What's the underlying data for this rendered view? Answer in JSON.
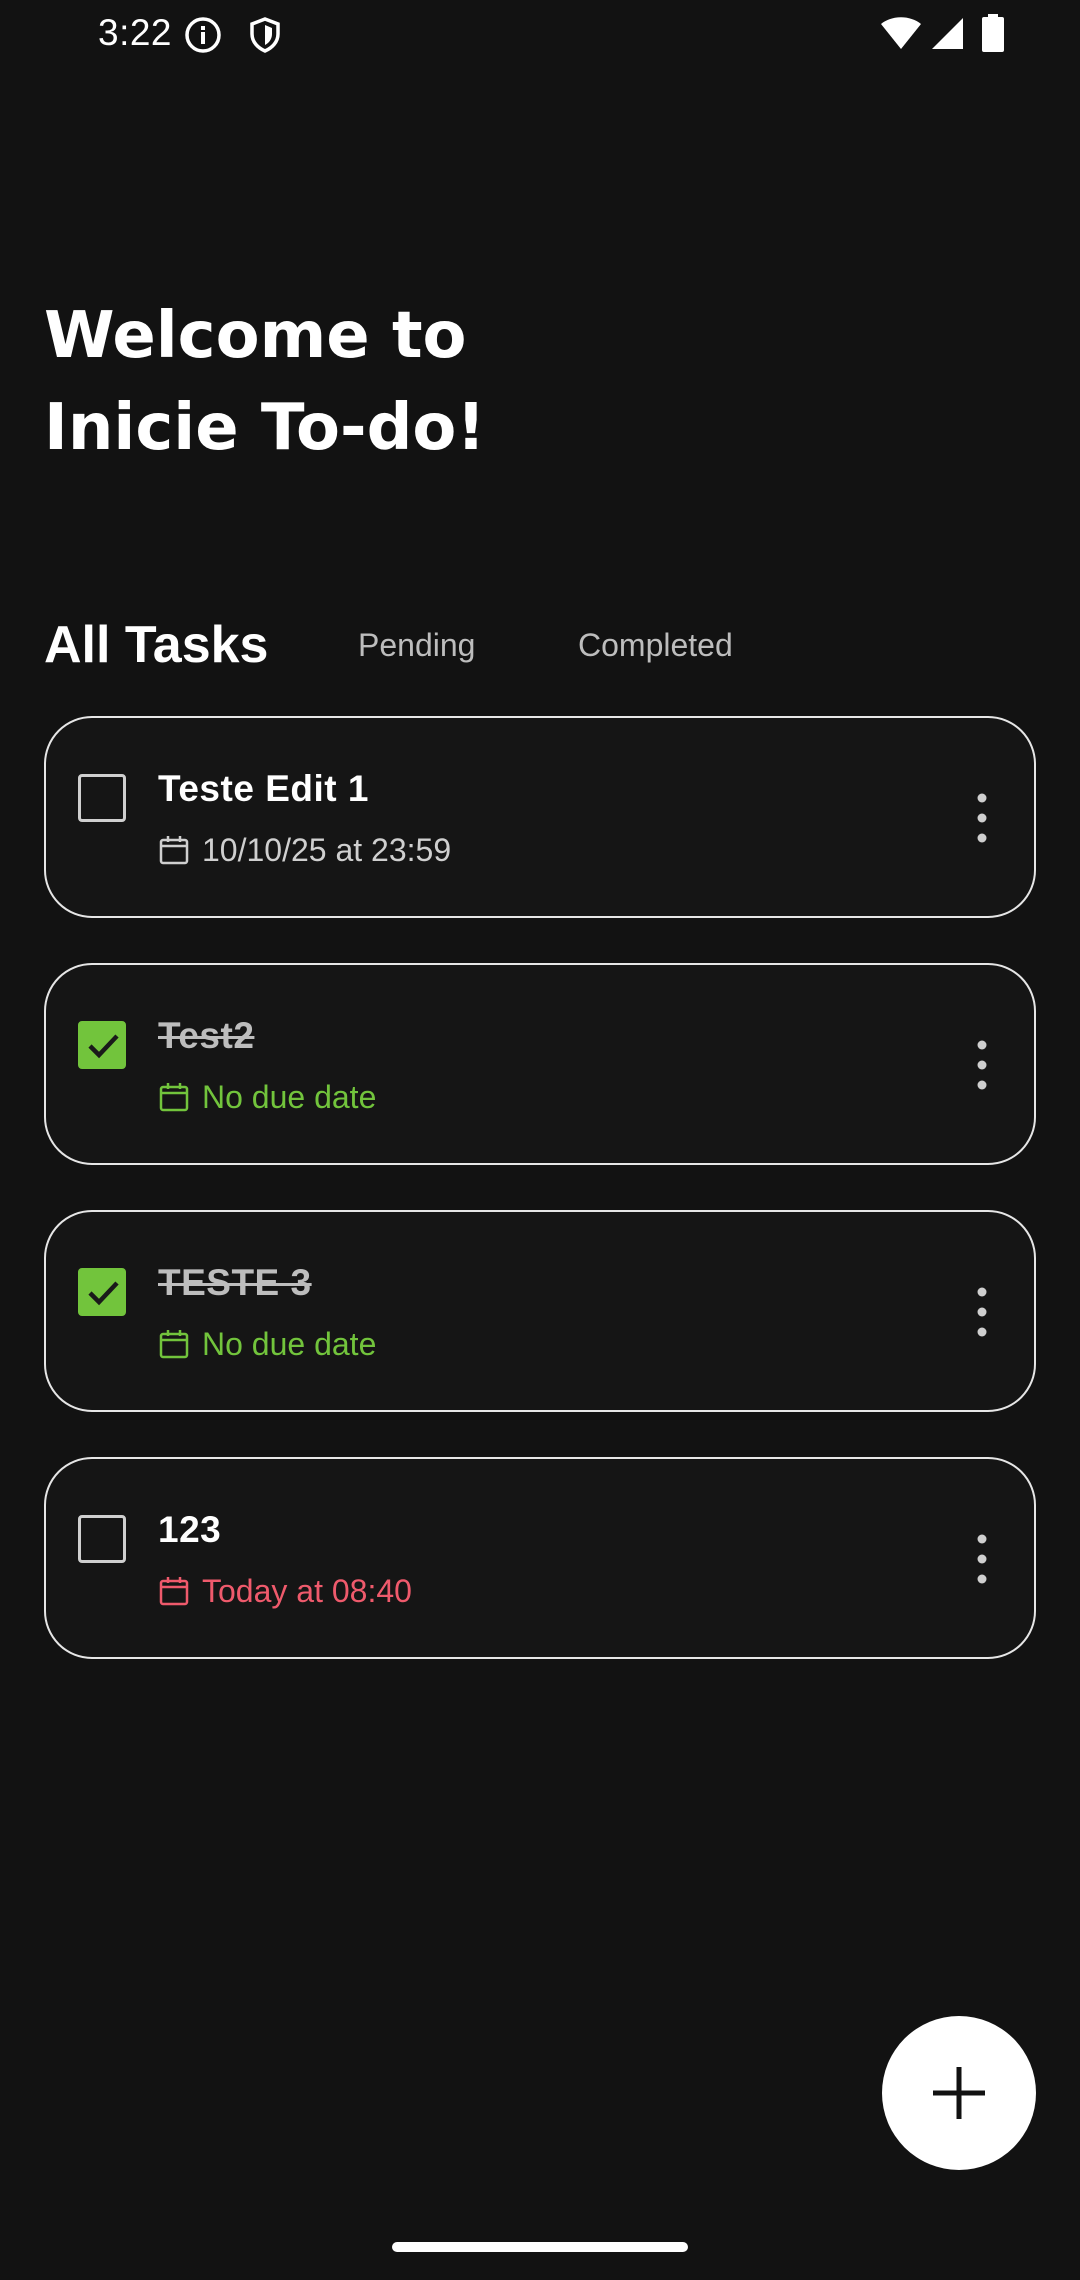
{
  "status_bar": {
    "time": "3:22",
    "left_icons": [
      "info-icon",
      "shield-icon"
    ],
    "right_icons": [
      "wifi-icon",
      "signal-icon",
      "battery-icon"
    ]
  },
  "header": {
    "line1": "Welcome to",
    "line2": "Inicie To-do!"
  },
  "tabs": [
    {
      "label": "All Tasks",
      "active": true
    },
    {
      "label": "Pending",
      "active": false
    },
    {
      "label": "Completed",
      "active": false
    }
  ],
  "tasks": [
    {
      "title": "Teste Edit 1",
      "due": "10/10/25 at 23:59",
      "completed": false,
      "due_color": "#cfcfcf"
    },
    {
      "title": "Test2",
      "due": "No due date",
      "completed": true,
      "due_color": "#72c43c"
    },
    {
      "title": "TESTE 3",
      "due": "No due date",
      "completed": true,
      "due_color": "#72c43c"
    },
    {
      "title": "123",
      "due": "Today at 08:40",
      "completed": false,
      "due_color": "#ef5a6c"
    }
  ],
  "fab": {
    "icon": "plus-icon"
  },
  "colors": {
    "background": "#121212",
    "accent_green": "#72c43c",
    "overdue_red": "#ef5a6c",
    "card_border": "#e6e6e6"
  }
}
